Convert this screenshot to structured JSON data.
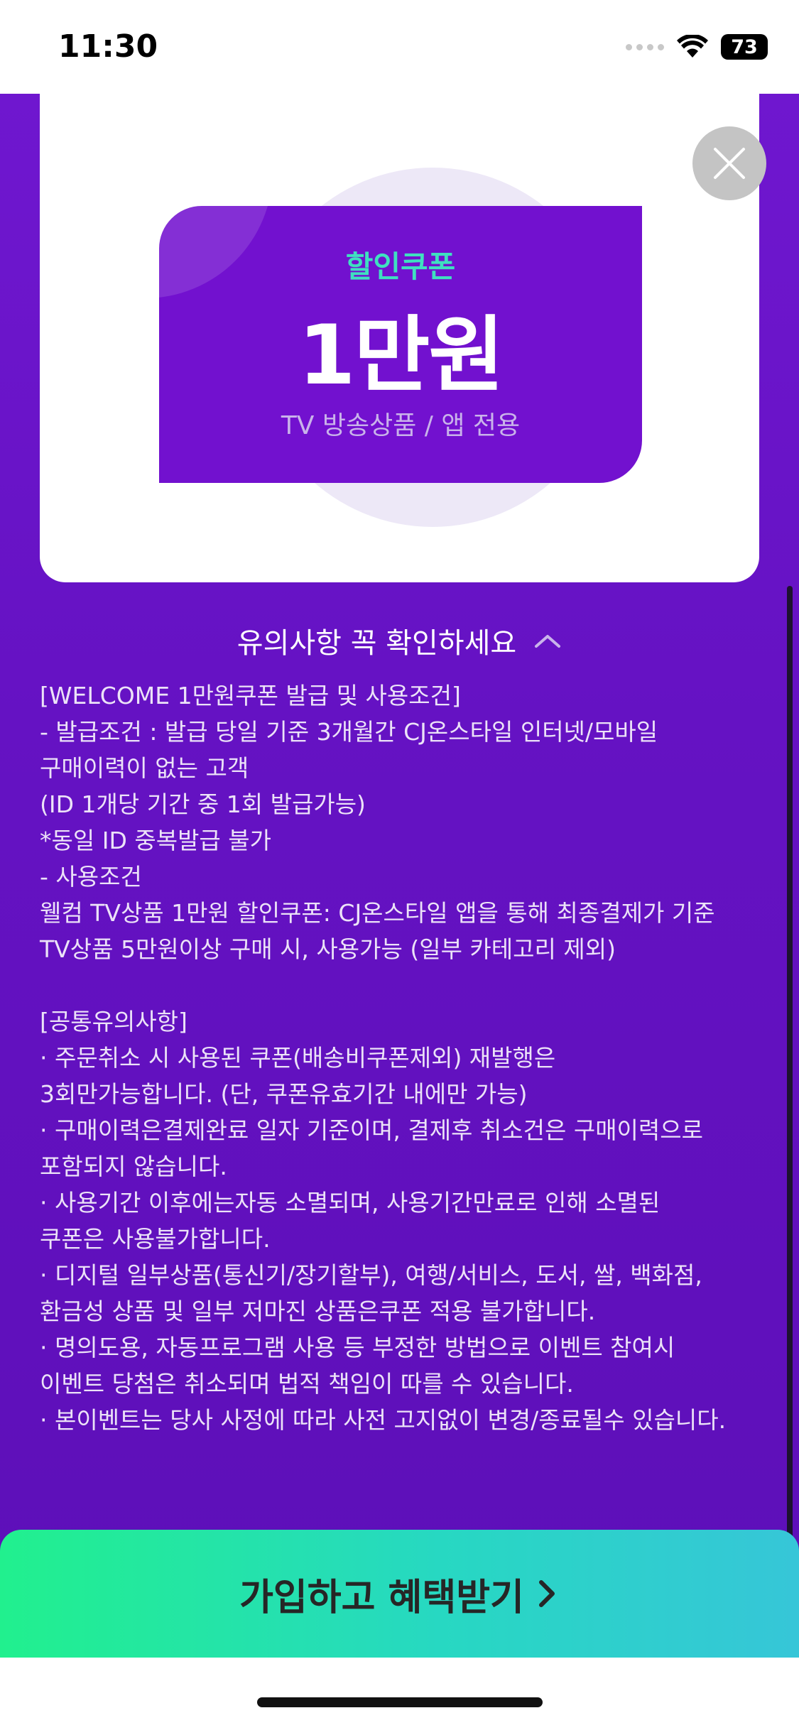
{
  "status_bar": {
    "time": "11:30",
    "battery": "73"
  },
  "coupon": {
    "label": "할인쿠폰",
    "amount": "1만원",
    "subtitle": "TV 방송상품 / 앱 전용"
  },
  "notice": {
    "toggle_label": "유의사항 꼭 확인하세요",
    "lines": [
      "[WELCOME 1만원쿠폰 발급 및 사용조건]",
      "- 발급조건 : 발급 당일 기준 3개월간 CJ온스타일 인터넷/모바일",
      "구매이력이 없는 고객",
      "(ID 1개당 기간 중 1회 발급가능)",
      "*동일 ID 중복발급 불가",
      "- 사용조건",
      "웰컴 TV상품 1만원 할인쿠폰: CJ온스타일 앱을 통해 최종결제가 기준",
      "TV상품 5만원이상 구매 시, 사용가능 (일부 카테고리 제외)",
      "",
      "[공통유의사항]",
      "· 주문취소 시 사용된 쿠폰(배송비쿠폰제외) 재발행은",
      "3회만가능합니다. (단, 쿠폰유효기간 내에만 가능)",
      "· 구매이력은결제완료 일자 기준이며, 결제후 취소건은 구매이력으로",
      "포함되지 않습니다.",
      "· 사용기간 이후에는자동 소멸되며, 사용기간만료로 인해 소멸된",
      "쿠폰은 사용불가합니다.",
      "· 디지털 일부상품(통신기/장기할부), 여행/서비스, 도서, 쌀, 백화점,",
      "환금성 상품 및 일부 저마진 상품은쿠폰 적용 불가합니다.",
      "· 명의도용, 자동프로그램 사용 등 부정한 방법으로 이벤트 참여시",
      "이벤트 당첨은 취소되며 법적 책임이 따를 수 있습니다.",
      "· 본이벤트는 당사 사정에 따라 사전 고지없이 변경/종료될수 있습니다."
    ]
  },
  "cta": {
    "label": "가입하고 혜택받기"
  },
  "icons": {
    "close": "close-icon",
    "toggle": "chevron-up-icon",
    "cta_arrow": "chevron-right-icon"
  },
  "colors": {
    "background": "#6512c3",
    "coupon": "#7211cf",
    "coupon_label": "#3fe0c0",
    "cta_start": "#21f08e",
    "cta_end": "#36c6d8"
  }
}
